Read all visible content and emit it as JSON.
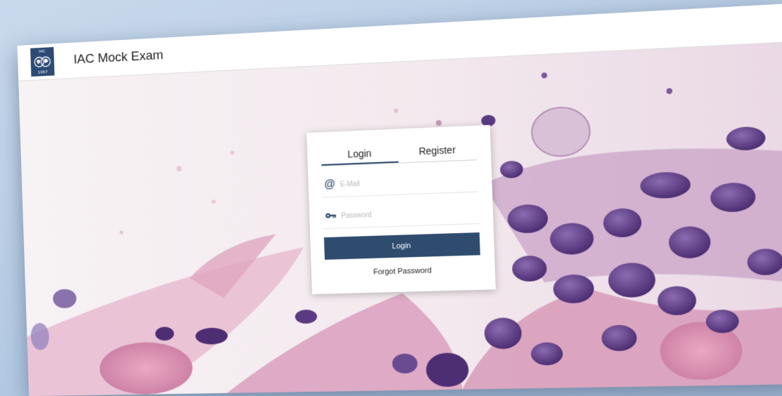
{
  "header": {
    "logo_top_text": "IAC",
    "logo_bottom_text": "1957",
    "title": "IAC Mock Exam"
  },
  "login_card": {
    "tabs": [
      {
        "label": "Login",
        "active": true
      },
      {
        "label": "Register",
        "active": false
      }
    ],
    "email_placeholder": "E-Mail",
    "password_placeholder": "Password",
    "login_button_label": "Login",
    "forgot_password_label": "Forgot Password"
  },
  "colors": {
    "accent": "#2f4c6f",
    "logo_bg": "#2c4a75"
  },
  "icons": {
    "email": "at-sign-icon",
    "password": "key-icon"
  }
}
